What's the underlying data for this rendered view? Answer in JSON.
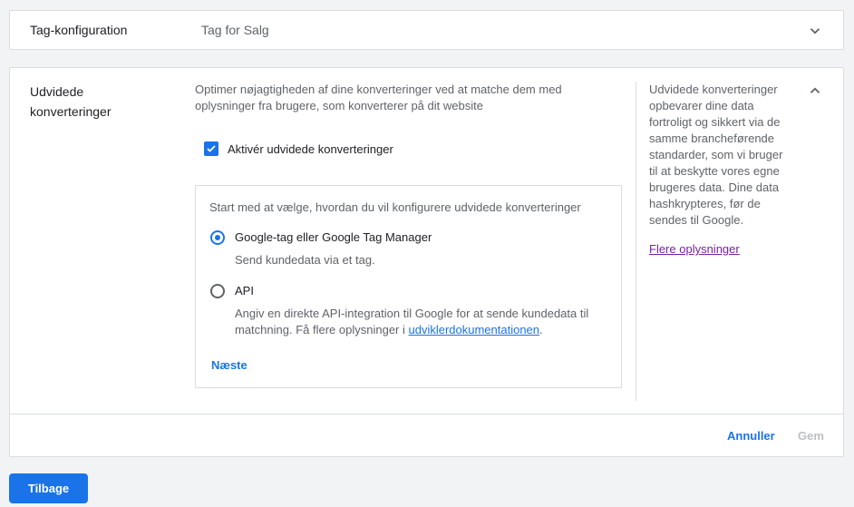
{
  "tag_config": {
    "title": "Tag-konfiguration",
    "value": "Tag for Salg",
    "toggle_icon": "chevron-down-icon"
  },
  "enhanced": {
    "title": "Udvidede konverteringer",
    "intro": "Optimer nøjagtigheden af dine konverteringer ved at matche dem med oplysninger fra brugere, som konverterer på dit website",
    "checkbox_label": "Aktivér udvidede konverteringer",
    "checkbox_checked": true,
    "setup": {
      "title": "Start med at vælge, hvordan du vil konfigurere udvidede konverteringer",
      "options": [
        {
          "label": "Google-tag eller Google Tag Manager",
          "desc": "Send kundedata via et tag.",
          "selected": true
        },
        {
          "label": "API",
          "desc_prefix": "Angiv en direkte API-integration til Google for at sende kundedata til matchning. Få flere oplysninger i ",
          "link": "udviklerdokumentationen",
          "desc_suffix": ".",
          "selected": false
        }
      ],
      "next_label": "Næste"
    },
    "side_text": "Udvidede konverteringer opbevarer dine data fortroligt og sikkert via de samme brancheførende standarder, som vi bruger til at beskytte vores egne brugeres data. Dine data hashkrypteres, før de sendes til Google.",
    "side_link": "Flere oplysninger",
    "toggle_icon": "chevron-up-icon",
    "cancel_label": "Annuller",
    "save_label": "Gem"
  },
  "back_label": "Tilbage",
  "colors": {
    "accent": "#1a73e8",
    "link_visited": "#7b1fa2",
    "disabled": "#bdc1c6"
  }
}
